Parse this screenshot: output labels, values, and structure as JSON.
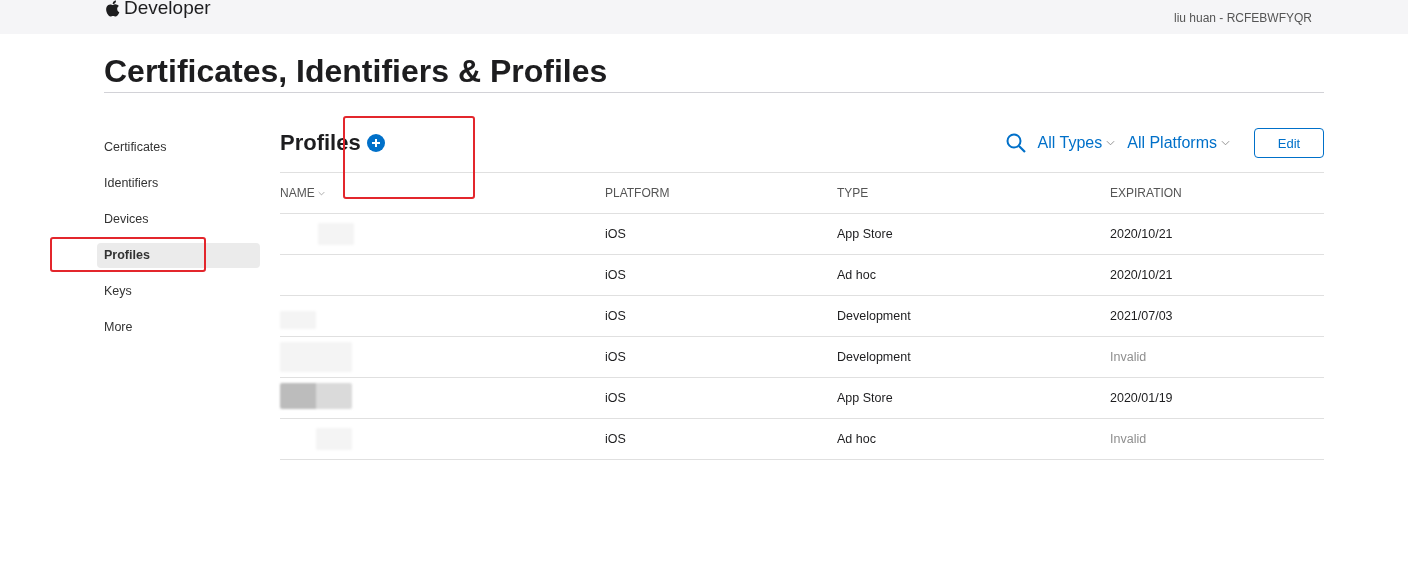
{
  "header": {
    "brand": "Developer",
    "account": "liu huan - RCFEBWFYQR"
  },
  "title": "Certificates, Identifiers & Profiles",
  "sidebar": {
    "items": [
      {
        "label": "Certificates",
        "selected": false
      },
      {
        "label": "Identifiers",
        "selected": false
      },
      {
        "label": "Devices",
        "selected": false
      },
      {
        "label": "Profiles",
        "selected": true
      },
      {
        "label": "Keys",
        "selected": false
      },
      {
        "label": "More",
        "selected": false
      }
    ]
  },
  "section": {
    "heading": "Profiles",
    "filters": [
      "All Types",
      "All Platforms"
    ],
    "edit_button": "Edit"
  },
  "table": {
    "columns": [
      {
        "label": "NAME",
        "sorted": true
      },
      {
        "label": "PLATFORM",
        "sorted": false
      },
      {
        "label": "TYPE",
        "sorted": false
      },
      {
        "label": "EXPIRATION",
        "sorted": false
      }
    ],
    "rows": [
      {
        "platform": "iOS",
        "type": "App Store",
        "expiration": "2020/10/21",
        "invalid": false
      },
      {
        "platform": "iOS",
        "type": "Ad hoc",
        "expiration": "2020/10/21",
        "invalid": false
      },
      {
        "platform": "iOS",
        "type": "Development",
        "expiration": "2021/07/03",
        "invalid": false
      },
      {
        "platform": "iOS",
        "type": "Development",
        "expiration": "Invalid",
        "invalid": true
      },
      {
        "platform": "iOS",
        "type": "App Store",
        "expiration": "2020/01/19",
        "invalid": false
      },
      {
        "platform": "iOS",
        "type": "Ad hoc",
        "expiration": "Invalid",
        "invalid": true
      }
    ]
  }
}
